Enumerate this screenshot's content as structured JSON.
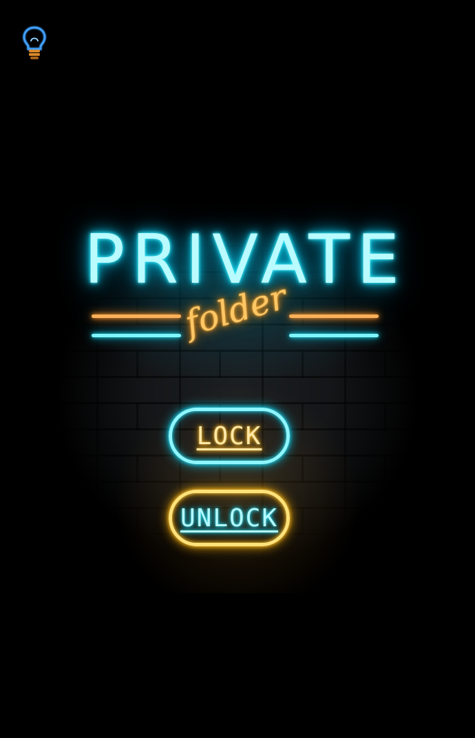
{
  "header": {
    "bulb_icon": "lightbulb-icon"
  },
  "sign": {
    "title": "PRIVATE",
    "subtitle": "folder"
  },
  "actions": {
    "lock_label": "LOCK",
    "unlock_label": "UNLOCK"
  },
  "colors": {
    "background": "#000000",
    "neon_cyan": "#19dcf2",
    "neon_orange": "#ffa637",
    "neon_yellow": "#ffc62e"
  }
}
